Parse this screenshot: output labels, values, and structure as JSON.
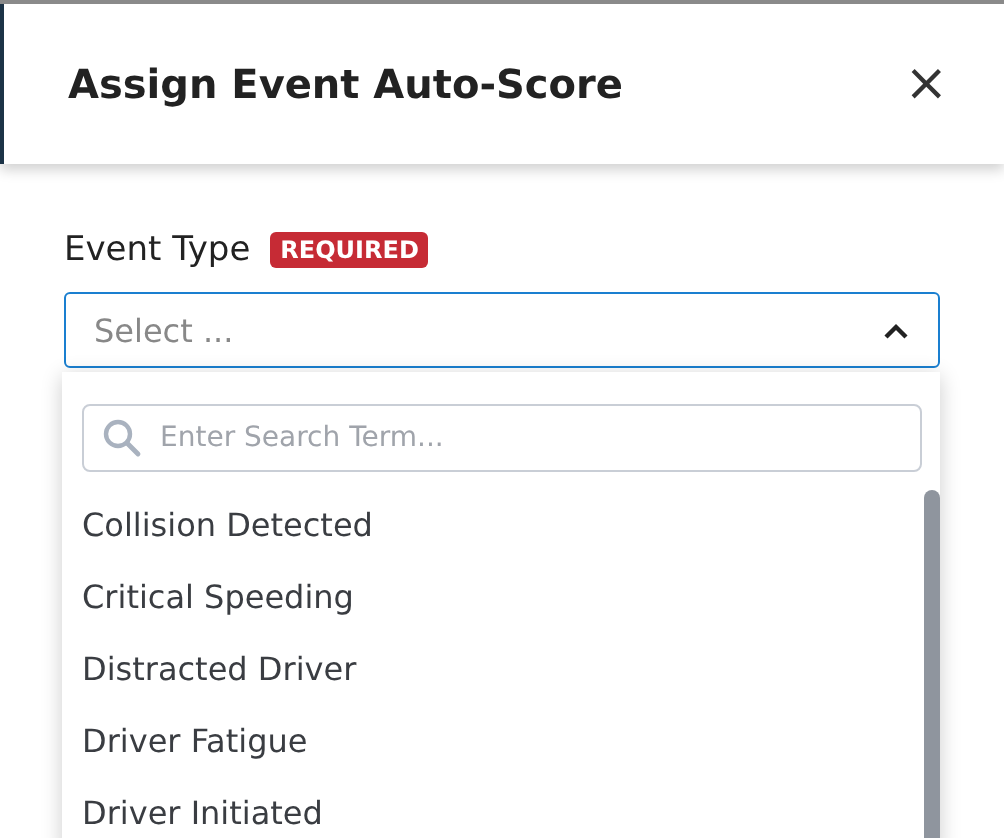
{
  "dialog": {
    "title": "Assign Event Auto-Score",
    "close": "×"
  },
  "field": {
    "label": "Event Type",
    "badge": "REQUIRED",
    "placeholder": "Select ...",
    "expanded": true
  },
  "dropdown": {
    "search_placeholder": "Enter Search Term...",
    "options": [
      {
        "label": "Collision Detected"
      },
      {
        "label": "Critical Speeding"
      },
      {
        "label": "Distracted Driver"
      },
      {
        "label": "Driver Fatigue"
      },
      {
        "label": "Driver Initiated"
      }
    ]
  }
}
